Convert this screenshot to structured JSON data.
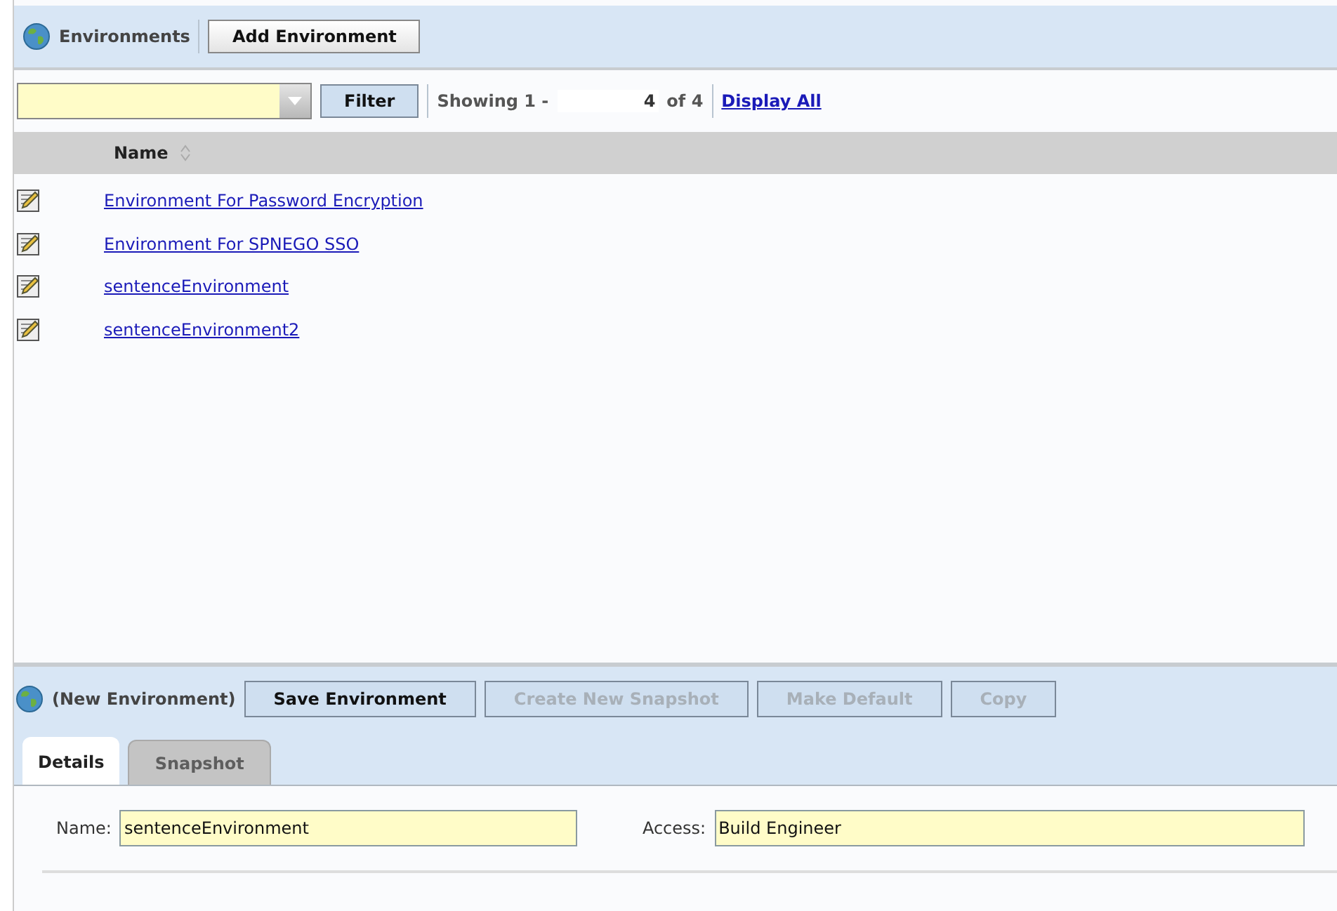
{
  "top_toolbar": {
    "title": "Environments",
    "button": "Add Environment"
  },
  "filter_bar": {
    "filter_button": "Filter",
    "showing_label": "Showing 1 -",
    "page_end": "4",
    "total_label": "of 4",
    "display_all_link": "Display All"
  },
  "table": {
    "columns": [
      "Name"
    ],
    "rows": [
      {
        "name": "Environment For Password Encryption"
      },
      {
        "name": "Environment For SPNEGO SSO"
      },
      {
        "name": "sentenceEnvironment"
      },
      {
        "name": "sentenceEnvironment2"
      }
    ]
  },
  "detail_toolbar": {
    "title": "(New Environment)",
    "buttons": [
      {
        "label": "Save Environment",
        "disabled": false
      },
      {
        "label": "Create New Snapshot",
        "disabled": true
      },
      {
        "label": "Make Default",
        "disabled": true
      },
      {
        "label": "Copy",
        "disabled": true
      }
    ]
  },
  "tabs": [
    {
      "label": "Details",
      "selected": true
    },
    {
      "label": "Snapshot",
      "selected": false
    }
  ],
  "form": {
    "name_label": "Name:",
    "name_value": "sentenceEnvironment",
    "access_label": "Access:",
    "access_value": "Build Engineer"
  }
}
